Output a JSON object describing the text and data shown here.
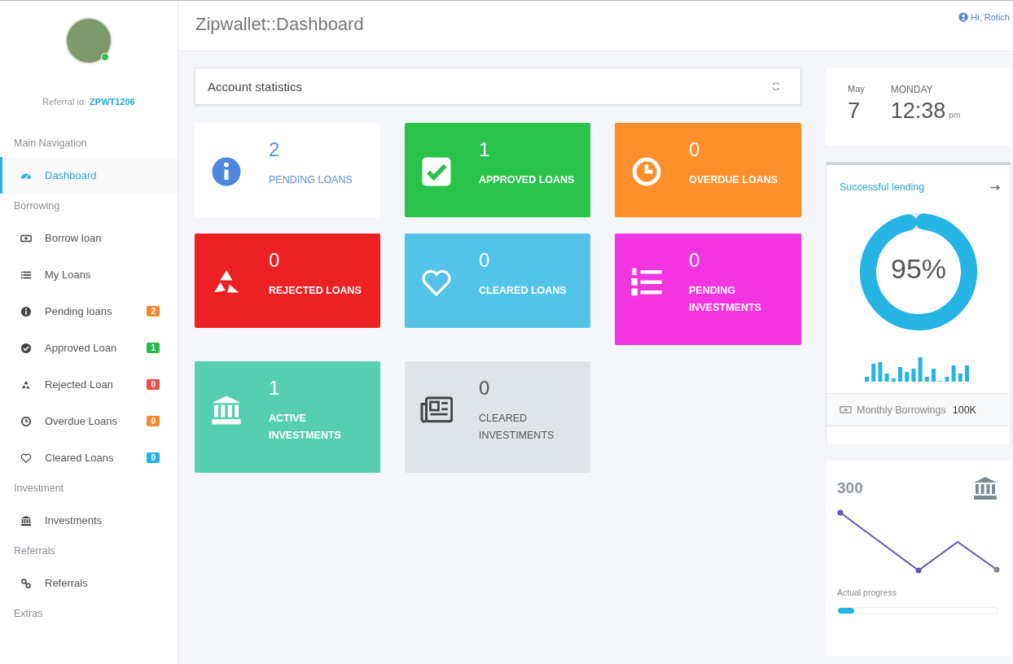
{
  "sidebar": {
    "profile": {
      "online": true,
      "referral_label": "Referral id:",
      "referral_id": "ZPWT1206"
    },
    "sections": [
      {
        "heading": "Main Navigation",
        "items": [
          {
            "label": "Dashboard",
            "selected": true
          }
        ]
      },
      {
        "heading": "Borrowing",
        "items": [
          {
            "label": "Borrow loan",
            "selected": false
          },
          {
            "label": "My Loans",
            "selected": false
          },
          {
            "label": "Pending loans",
            "selected": false,
            "badge": "2",
            "color": "#f7882f"
          },
          {
            "label": "Approved Loan",
            "selected": false,
            "badge": "1",
            "color": "#2ab84b"
          },
          {
            "label": "Rejected Loan",
            "selected": false,
            "badge": "0",
            "color": "#e84c4c"
          },
          {
            "label": "Overdue Loans",
            "selected": false,
            "badge": "0",
            "color": "#f7882f"
          },
          {
            "label": "Cleared Loans",
            "selected": false,
            "badge": "0",
            "color": "#23b2e0"
          }
        ]
      },
      {
        "heading": "Investment",
        "items": [
          {
            "label": "Investments",
            "selected": false
          }
        ]
      },
      {
        "heading": "Referrals",
        "items": [
          {
            "label": "Referrals",
            "selected": false
          }
        ]
      },
      {
        "heading": "Extras"
      }
    ]
  },
  "header": {
    "title": "Zipwallet::Dashboard",
    "user": "Hi, Rotich"
  },
  "statistics": {
    "title": "Account statistics",
    "tiles": [
      {
        "count": "2",
        "label": "PENDING LOANS",
        "kind": "light",
        "color": "#ffffff"
      },
      {
        "count": "1",
        "label": "APPROVED LOANS",
        "kind": "solid",
        "color": "#29c24b"
      },
      {
        "count": "0",
        "label": "OVERDUE LOANS",
        "kind": "solid",
        "color": "#ff8f2b"
      },
      {
        "count": "0",
        "label": "REJECTED LOANS",
        "kind": "solid",
        "color": "#ed2024"
      },
      {
        "count": "0",
        "label": "CLEARED LOANS",
        "kind": "solid",
        "color": "#53c4e8"
      },
      {
        "count": "0",
        "label": "PENDING INVESTMENTS",
        "kind": "solid",
        "color": "#f235e1"
      },
      {
        "count": "1",
        "label": "ACTIVE INVESTMENTS",
        "kind": "solid",
        "color": "#56cfb0"
      },
      {
        "count": "0",
        "label": "CLEARED INVESTIMENTS",
        "kind": "grey",
        "color": "#dee4e8"
      }
    ]
  },
  "date_card": {
    "month": "May",
    "day": "7",
    "weekday": "MONDAY",
    "time": "12:38",
    "ampm": "pm"
  },
  "lending_card": {
    "title": "Successful lending",
    "level": 0.95,
    "percent": "95%",
    "footer_label": "Monthly Borrowings",
    "footer_value": "100K"
  },
  "progress_card": {
    "value": "300",
    "progress_label": "Actual progress",
    "level": 0.1
  }
}
